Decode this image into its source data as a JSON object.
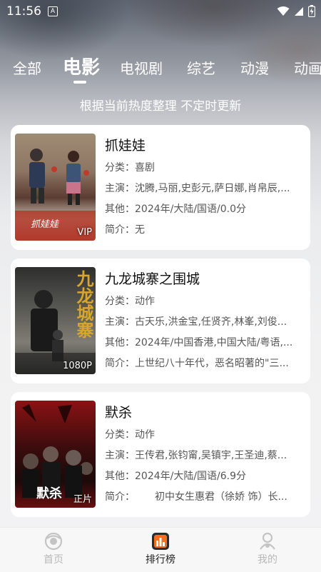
{
  "status_bar": {
    "time": "11:56",
    "app_icon": "A"
  },
  "tabs": [
    {
      "label": "全部",
      "active": false
    },
    {
      "label": "电影",
      "active": true
    },
    {
      "label": "电视剧",
      "active": false
    },
    {
      "label": "综艺",
      "active": false
    },
    {
      "label": "动漫",
      "active": false
    },
    {
      "label": "动画",
      "active": false
    }
  ],
  "subtitle": "根据当前热度整理 不定时更新",
  "movies": [
    {
      "title": "抓娃娃",
      "category_label": "分类：",
      "category": "喜剧",
      "cast_label": "主演：",
      "cast": "沈腾,马丽,史彭元,萨日娜,肖帛辰,...",
      "other_label": "其他：",
      "other": "2024年/大陆/国语/0.0分",
      "intro_label": "简介：",
      "intro": "无",
      "badge": "VIP",
      "poster_text": "抓娃娃",
      "poster_colors": [
        "#b8a48a",
        "#6b4a3c",
        "#c9c2b5"
      ]
    },
    {
      "title": "九龙城寨之围城",
      "category_label": "分类：",
      "category": "动作",
      "cast_label": "主演：",
      "cast": "古天乐,洪金宝,任贤齐,林峯,刘俊...",
      "other_label": "其他：",
      "other": "2024年/中国香港,中国大陆/粤语,...",
      "intro_label": "简介：",
      "intro": "上世纪八十年代，恶名昭著的\"三...",
      "badge": "1080P",
      "poster_text": "九龙城寨",
      "poster_colors": [
        "#3a3a3a",
        "#6a6a66",
        "#9a9890"
      ]
    },
    {
      "title": "默杀",
      "category_label": "分类：",
      "category": "动作",
      "cast_label": "主演：",
      "cast": "王传君,张钧甯,吴镇宇,王圣迪,蔡...",
      "other_label": "其他：",
      "other": "2024年/大陆/国语/6.9分",
      "intro_label": "简介：",
      "intro": "初中女生惠君（徐娇 饰）长...",
      "badge": "正片",
      "poster_text": "默杀",
      "poster_colors": [
        "#7a0f12",
        "#2a0a0b",
        "#b01a1c"
      ]
    }
  ],
  "bottom_nav": [
    {
      "label": "首页",
      "icon": "home-icon",
      "active": false
    },
    {
      "label": "排行榜",
      "icon": "ranking-icon",
      "active": true
    },
    {
      "label": "我的",
      "icon": "profile-icon",
      "active": false
    }
  ],
  "colors": {
    "accent": "#f07020",
    "text_dark": "#111111",
    "text_gray": "#555555",
    "inactive": "#b8b8b8"
  }
}
